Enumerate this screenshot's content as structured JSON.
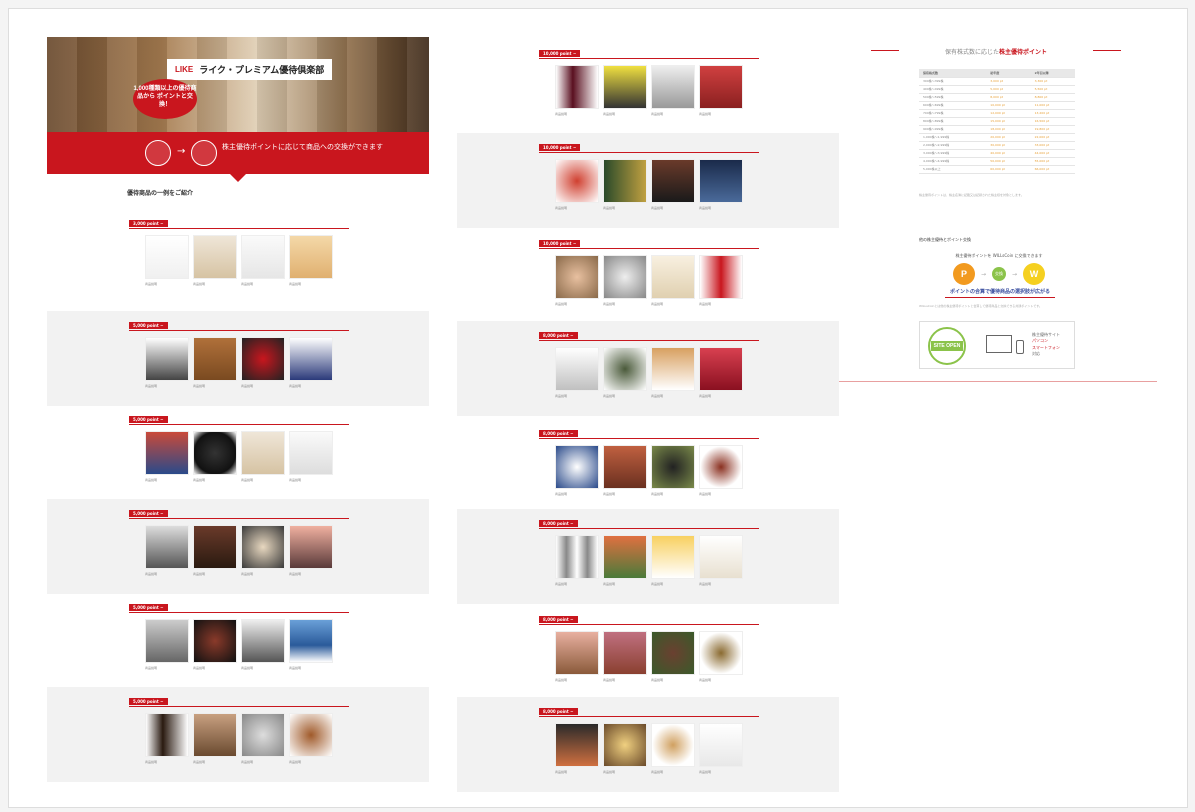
{
  "hero": {
    "brand": "LIKE",
    "title": "ライク・プレミアム優待倶楽部",
    "bubble": "1,000種類以上の優待商品から ポイントと交換！",
    "band_text": "株主優待ポイントに応じて商品への交換ができます"
  },
  "intro": {
    "heading": "優待商品の一例をご紹介"
  },
  "col1_blocks": [
    {
      "tag": "3,000 point ~",
      "captions": [
        "商品説明",
        "商品説明",
        "商品説明",
        "商品説明"
      ]
    },
    {
      "tag": "5,000 point ~",
      "captions": [
        "商品説明",
        "商品説明",
        "商品説明",
        "商品説明"
      ]
    },
    {
      "tag": "5,000 point ~",
      "captions": [
        "商品説明",
        "商品説明",
        "商品説明",
        "商品説明"
      ]
    },
    {
      "tag": "5,000 point ~",
      "captions": [
        "商品説明",
        "商品説明",
        "商品説明",
        "商品説明"
      ]
    },
    {
      "tag": "5,000 point ~",
      "captions": [
        "商品説明",
        "商品説明",
        "商品説明",
        "商品説明"
      ]
    },
    {
      "tag": "5,000 point ~",
      "captions": [
        "商品説明",
        "商品説明",
        "商品説明",
        "商品説明"
      ]
    }
  ],
  "col2_blocks": [
    {
      "tag": "10,000 point ~",
      "captions": [
        "商品説明",
        "商品説明",
        "商品説明",
        "商品説明"
      ]
    },
    {
      "tag": "10,000 point ~",
      "captions": [
        "商品説明",
        "商品説明",
        "商品説明",
        "商品説明"
      ]
    },
    {
      "tag": "10,000 point ~",
      "captions": [
        "商品説明",
        "商品説明",
        "商品説明",
        "商品説明"
      ]
    },
    {
      "tag": "8,000 point ~",
      "captions": [
        "商品説明",
        "商品説明",
        "商品説明",
        "商品説明"
      ]
    },
    {
      "tag": "8,000 point ~",
      "captions": [
        "商品説明",
        "商品説明",
        "商品説明",
        "商品説明"
      ]
    },
    {
      "tag": "8,000 point ~",
      "captions": [
        "商品説明",
        "商品説明",
        "商品説明",
        "商品説明"
      ]
    },
    {
      "tag": "8,000 point ~",
      "captions": [
        "商品説明",
        "商品説明",
        "商品説明",
        "商品説明"
      ]
    },
    {
      "tag": "8,000 point ~",
      "captions": [
        "商品説明",
        "商品説明",
        "商品説明",
        "商品説明"
      ]
    }
  ],
  "points": {
    "title_pre": "保有株式数に応じた",
    "title_red": "株主優待ポイント",
    "table_header": [
      "保有株式数",
      "初年度",
      "2年目以降"
    ],
    "rows": [
      [
        "300株～399株",
        "3,000 pt",
        "3,300 pt"
      ],
      [
        "400株～499株",
        "5,000 pt",
        "5,500 pt"
      ],
      [
        "500株～599株",
        "8,000 pt",
        "8,800 pt"
      ],
      [
        "600株～699株",
        "10,000 pt",
        "11,000 pt"
      ],
      [
        "700株～799株",
        "12,000 pt",
        "13,200 pt"
      ],
      [
        "800株～899株",
        "15,000 pt",
        "16,500 pt"
      ],
      [
        "900株～999株",
        "18,000 pt",
        "19,800 pt"
      ],
      [
        "1,000株～1,999株",
        "20,000 pt",
        "22,000 pt"
      ],
      [
        "2,000株～2,999株",
        "30,000 pt",
        "33,000 pt"
      ],
      [
        "3,000株～3,999株",
        "40,000 pt",
        "44,000 pt"
      ],
      [
        "4,000株～4,999株",
        "50,000 pt",
        "55,000 pt"
      ],
      [
        "5,000株以上",
        "60,000 pt",
        "66,000 pt"
      ]
    ],
    "note": "株主優待ポイントは、株主名簿に記載又は記録された株主様を対象とします。"
  },
  "wellness": {
    "heading": "他の株主優待とポイント交換",
    "question": "株主優待ポイントを WILLsCoin に交換できます",
    "p_icon": "P",
    "mid": "交換",
    "w_icon": "W",
    "underline": "ポイントの合算で優待商品の選択肢が広がる",
    "small": "WILLsCoinとは他の株主優待ポイントと合算して優待商品と交換できる共通ポイントです。"
  },
  "banner": {
    "seal": "SITE OPEN",
    "line1": "株主優待サイト",
    "line2": "パソコン",
    "line3": "スマートフォン",
    "line4": "対応"
  },
  "colors": {
    "accent": "#c9161e",
    "point": "#e8a23a",
    "green": "#8bc34a"
  }
}
